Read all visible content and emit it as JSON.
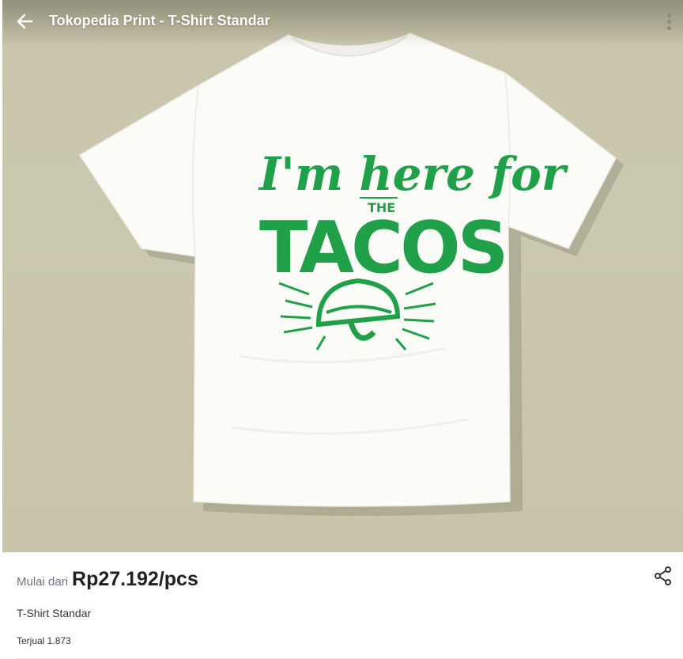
{
  "header": {
    "title": "Tokopedia Print - T-Shirt Standar",
    "back_icon": "arrow-left-icon",
    "more_icon": "more-vertical-icon"
  },
  "hero": {
    "shirt_color": "#ffffff",
    "print_color": "#21a04a",
    "print_text_line1": "I'm here for",
    "print_text_line2": "THE",
    "print_text_line3": "TACOS"
  },
  "product": {
    "price_prefix": "Mulai dari",
    "price": "Rp27.192/pcs",
    "name": "T-Shirt Standar",
    "sold": "Terjual 1.873",
    "share_icon": "share-icon"
  }
}
